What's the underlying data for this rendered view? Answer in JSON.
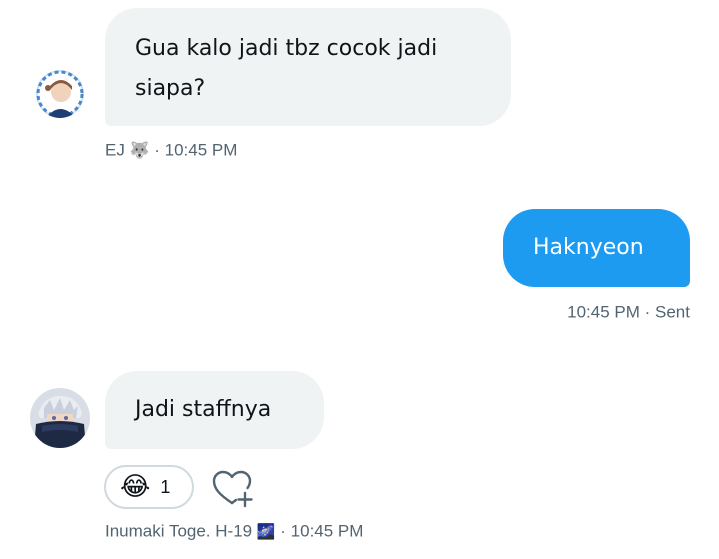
{
  "messages": [
    {
      "direction": "incoming",
      "text_line1": "Gua kalo jadi tbz cocok jadi",
      "text_line2": "siapa?",
      "sender_name": "EJ",
      "sender_emoji": "🐺",
      "separator": "·",
      "time": "10:45 PM"
    },
    {
      "direction": "outgoing",
      "text": "Haknyeon",
      "time": "10:45 PM",
      "separator": "·",
      "status": "Sent"
    },
    {
      "direction": "incoming",
      "text": "Jadi staffnya",
      "reaction": {
        "emoji": "😂",
        "count": "1"
      },
      "sender_name": "Inumaki Toge. H-19",
      "sender_emoji": "🌌",
      "separator": "·",
      "time": "10:45 PM"
    }
  ],
  "colors": {
    "outgoing_bubble": "#1d9bf0",
    "incoming_bubble": "#eff3f4",
    "meta_text": "#536471"
  },
  "icons": {
    "add_reaction": "heart-plus-icon"
  }
}
